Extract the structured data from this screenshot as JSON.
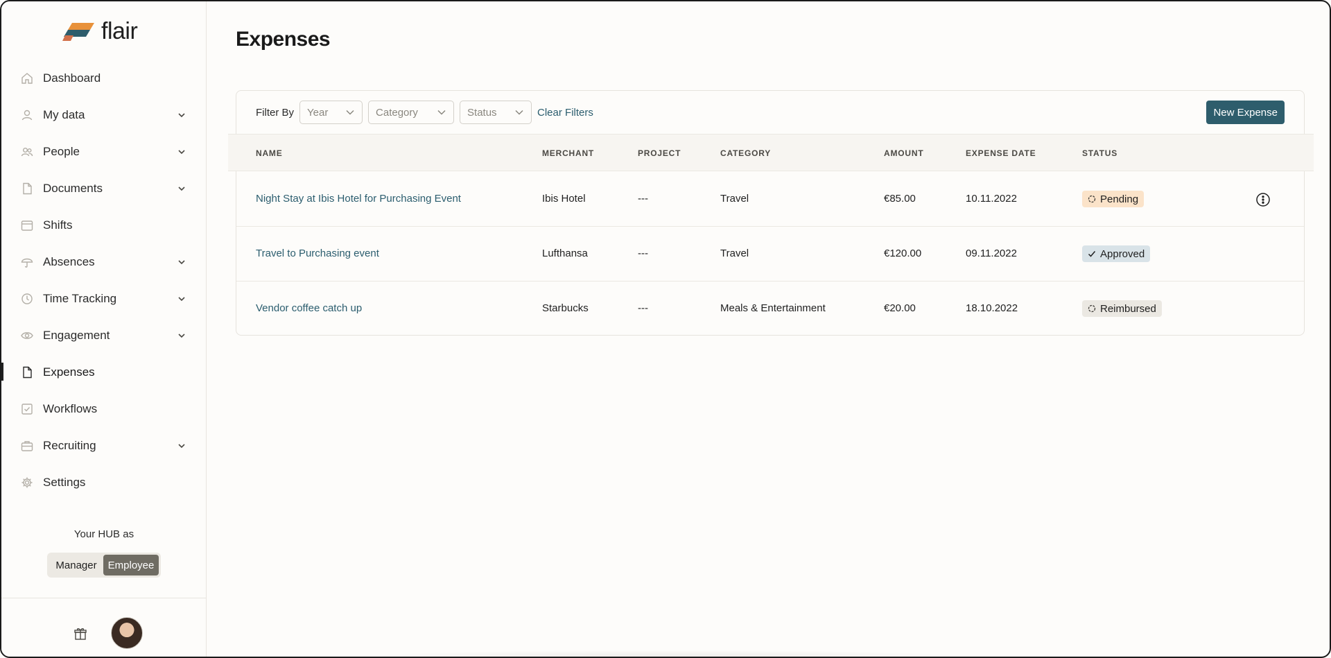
{
  "brand": {
    "name": "flair"
  },
  "page": {
    "title": "Expenses"
  },
  "sidebar": {
    "items": [
      {
        "label": "Dashboard",
        "icon": "home-icon",
        "expandable": false,
        "active": false
      },
      {
        "label": "My data",
        "icon": "user-icon",
        "expandable": true,
        "active": false
      },
      {
        "label": "People",
        "icon": "people-icon",
        "expandable": true,
        "active": false
      },
      {
        "label": "Documents",
        "icon": "document-icon",
        "expandable": true,
        "active": false
      },
      {
        "label": "Shifts",
        "icon": "calendar-icon",
        "expandable": false,
        "active": false
      },
      {
        "label": "Absences",
        "icon": "umbrella-icon",
        "expandable": true,
        "active": false
      },
      {
        "label": "Time Tracking",
        "icon": "clock-icon",
        "expandable": true,
        "active": false
      },
      {
        "label": "Engagement",
        "icon": "eye-icon",
        "expandable": true,
        "active": false
      },
      {
        "label": "Expenses",
        "icon": "file-icon",
        "expandable": false,
        "active": true
      },
      {
        "label": "Workflows",
        "icon": "checkbox-icon",
        "expandable": false,
        "active": false
      },
      {
        "label": "Recruiting",
        "icon": "briefcase-icon",
        "expandable": true,
        "active": false
      },
      {
        "label": "Settings",
        "icon": "gear-icon",
        "expandable": false,
        "active": false
      }
    ],
    "hub_label": "Your HUB as",
    "role_toggle": {
      "manager": "Manager",
      "employee": "Employee",
      "selected": "Employee"
    }
  },
  "filters": {
    "label": "Filter By",
    "year_placeholder": "Year",
    "category_placeholder": "Category",
    "status_placeholder": "Status",
    "clear_label": "Clear Filters"
  },
  "new_expense_label": "New Expense",
  "table": {
    "columns": [
      "NAME",
      "MERCHANT",
      "PROJECT",
      "CATEGORY",
      "AMOUNT",
      "EXPENSE DATE",
      "STATUS"
    ],
    "rows": [
      {
        "name": "Night Stay at Ibis Hotel for Purchasing Event",
        "merchant": "Ibis Hotel",
        "project": "---",
        "category": "Travel",
        "amount": "€85.00",
        "date": "10.11.2022",
        "status": "Pending"
      },
      {
        "name": "Travel to Purchasing event",
        "merchant": "Lufthansa",
        "project": "---",
        "category": "Travel",
        "amount": "€120.00",
        "date": "09.11.2022",
        "status": "Approved"
      },
      {
        "name": "Vendor coffee catch up",
        "merchant": "Starbucks",
        "project": "---",
        "category": "Meals & Entertainment",
        "amount": "€20.00",
        "date": "18.10.2022",
        "status": "Reimbursed"
      }
    ]
  },
  "colors": {
    "accent": "#2e5d6c",
    "link": "#2b5d6e",
    "pending_bg": "#fbe3c9",
    "approved_bg": "#d9e3e8",
    "reimbursed_bg": "#ebe8e2"
  }
}
